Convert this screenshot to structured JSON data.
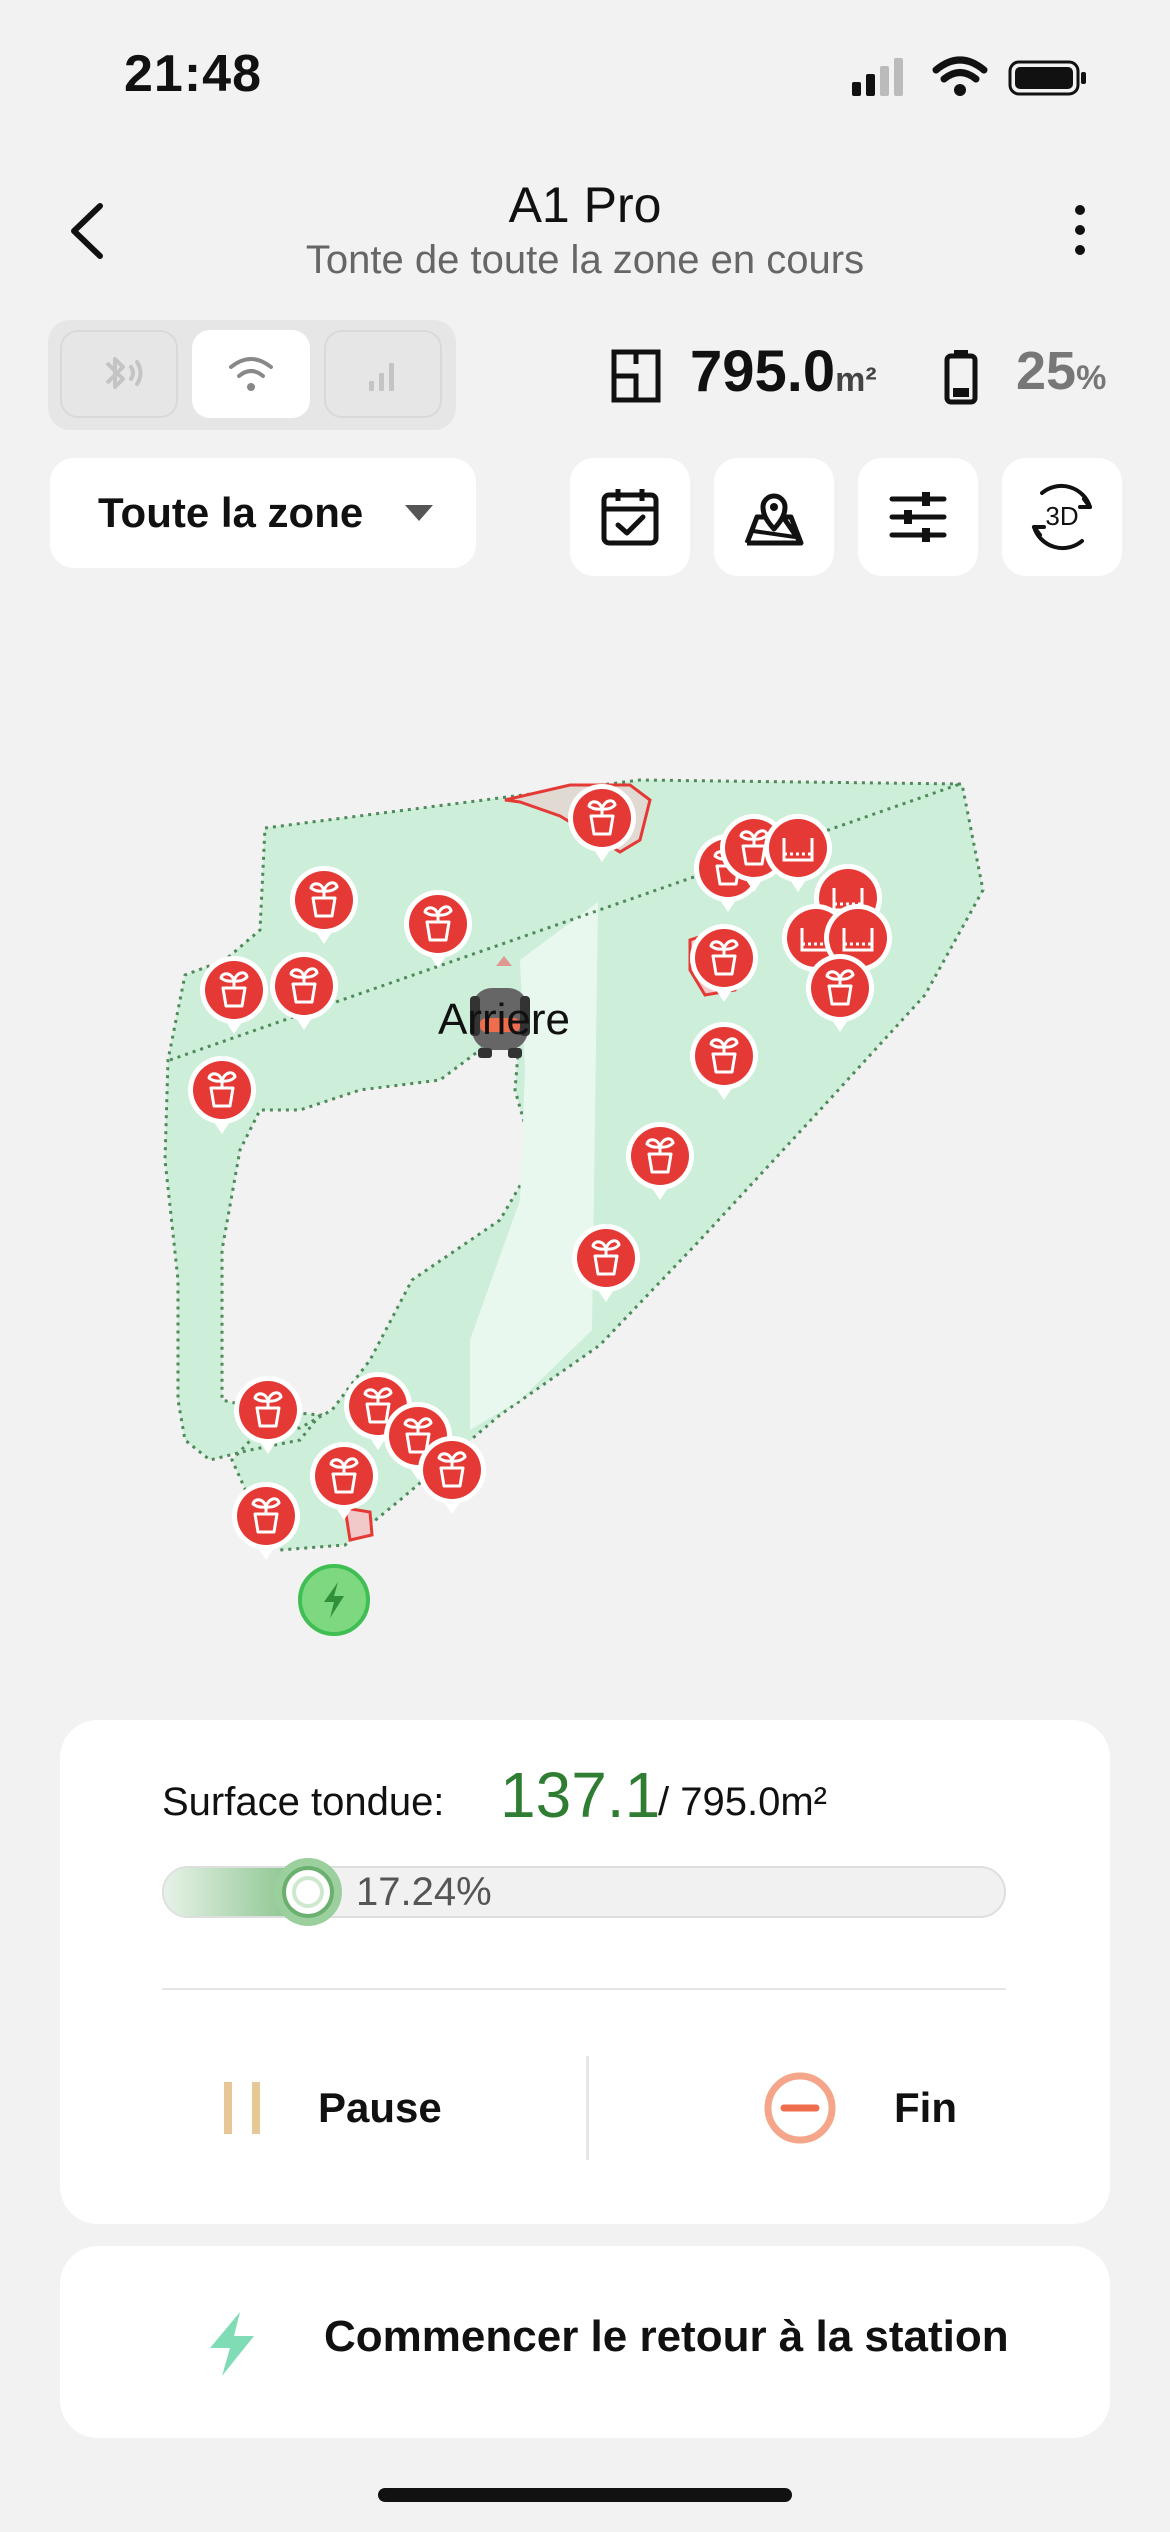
{
  "status_bar": {
    "time": "21:48"
  },
  "header": {
    "title": "A1 Pro",
    "subtitle": "Tonte de toute la zone en cours"
  },
  "connectivity": {
    "active": "wifi"
  },
  "stats": {
    "area_value": "795.0",
    "area_unit": "m²",
    "battery_value": "25",
    "battery_unit": "%"
  },
  "zone_selector": {
    "label": "Toute la zone"
  },
  "toolbar": {
    "view_3d_label": "3D"
  },
  "map": {
    "robot_label": "Arriere"
  },
  "mowing": {
    "label": "Surface tondue:",
    "value": "137.1",
    "total": "/ 795.0m²",
    "progress_text": "17.24%",
    "progress_fraction": 0.1724
  },
  "actions": {
    "pause_label": "Pause",
    "end_label": "Fin",
    "dock_label": "Commencer le retour à la station"
  },
  "colors": {
    "lawn": "#cdeed9",
    "obstacle": "#e53935",
    "accent_green": "#2e7d32"
  }
}
